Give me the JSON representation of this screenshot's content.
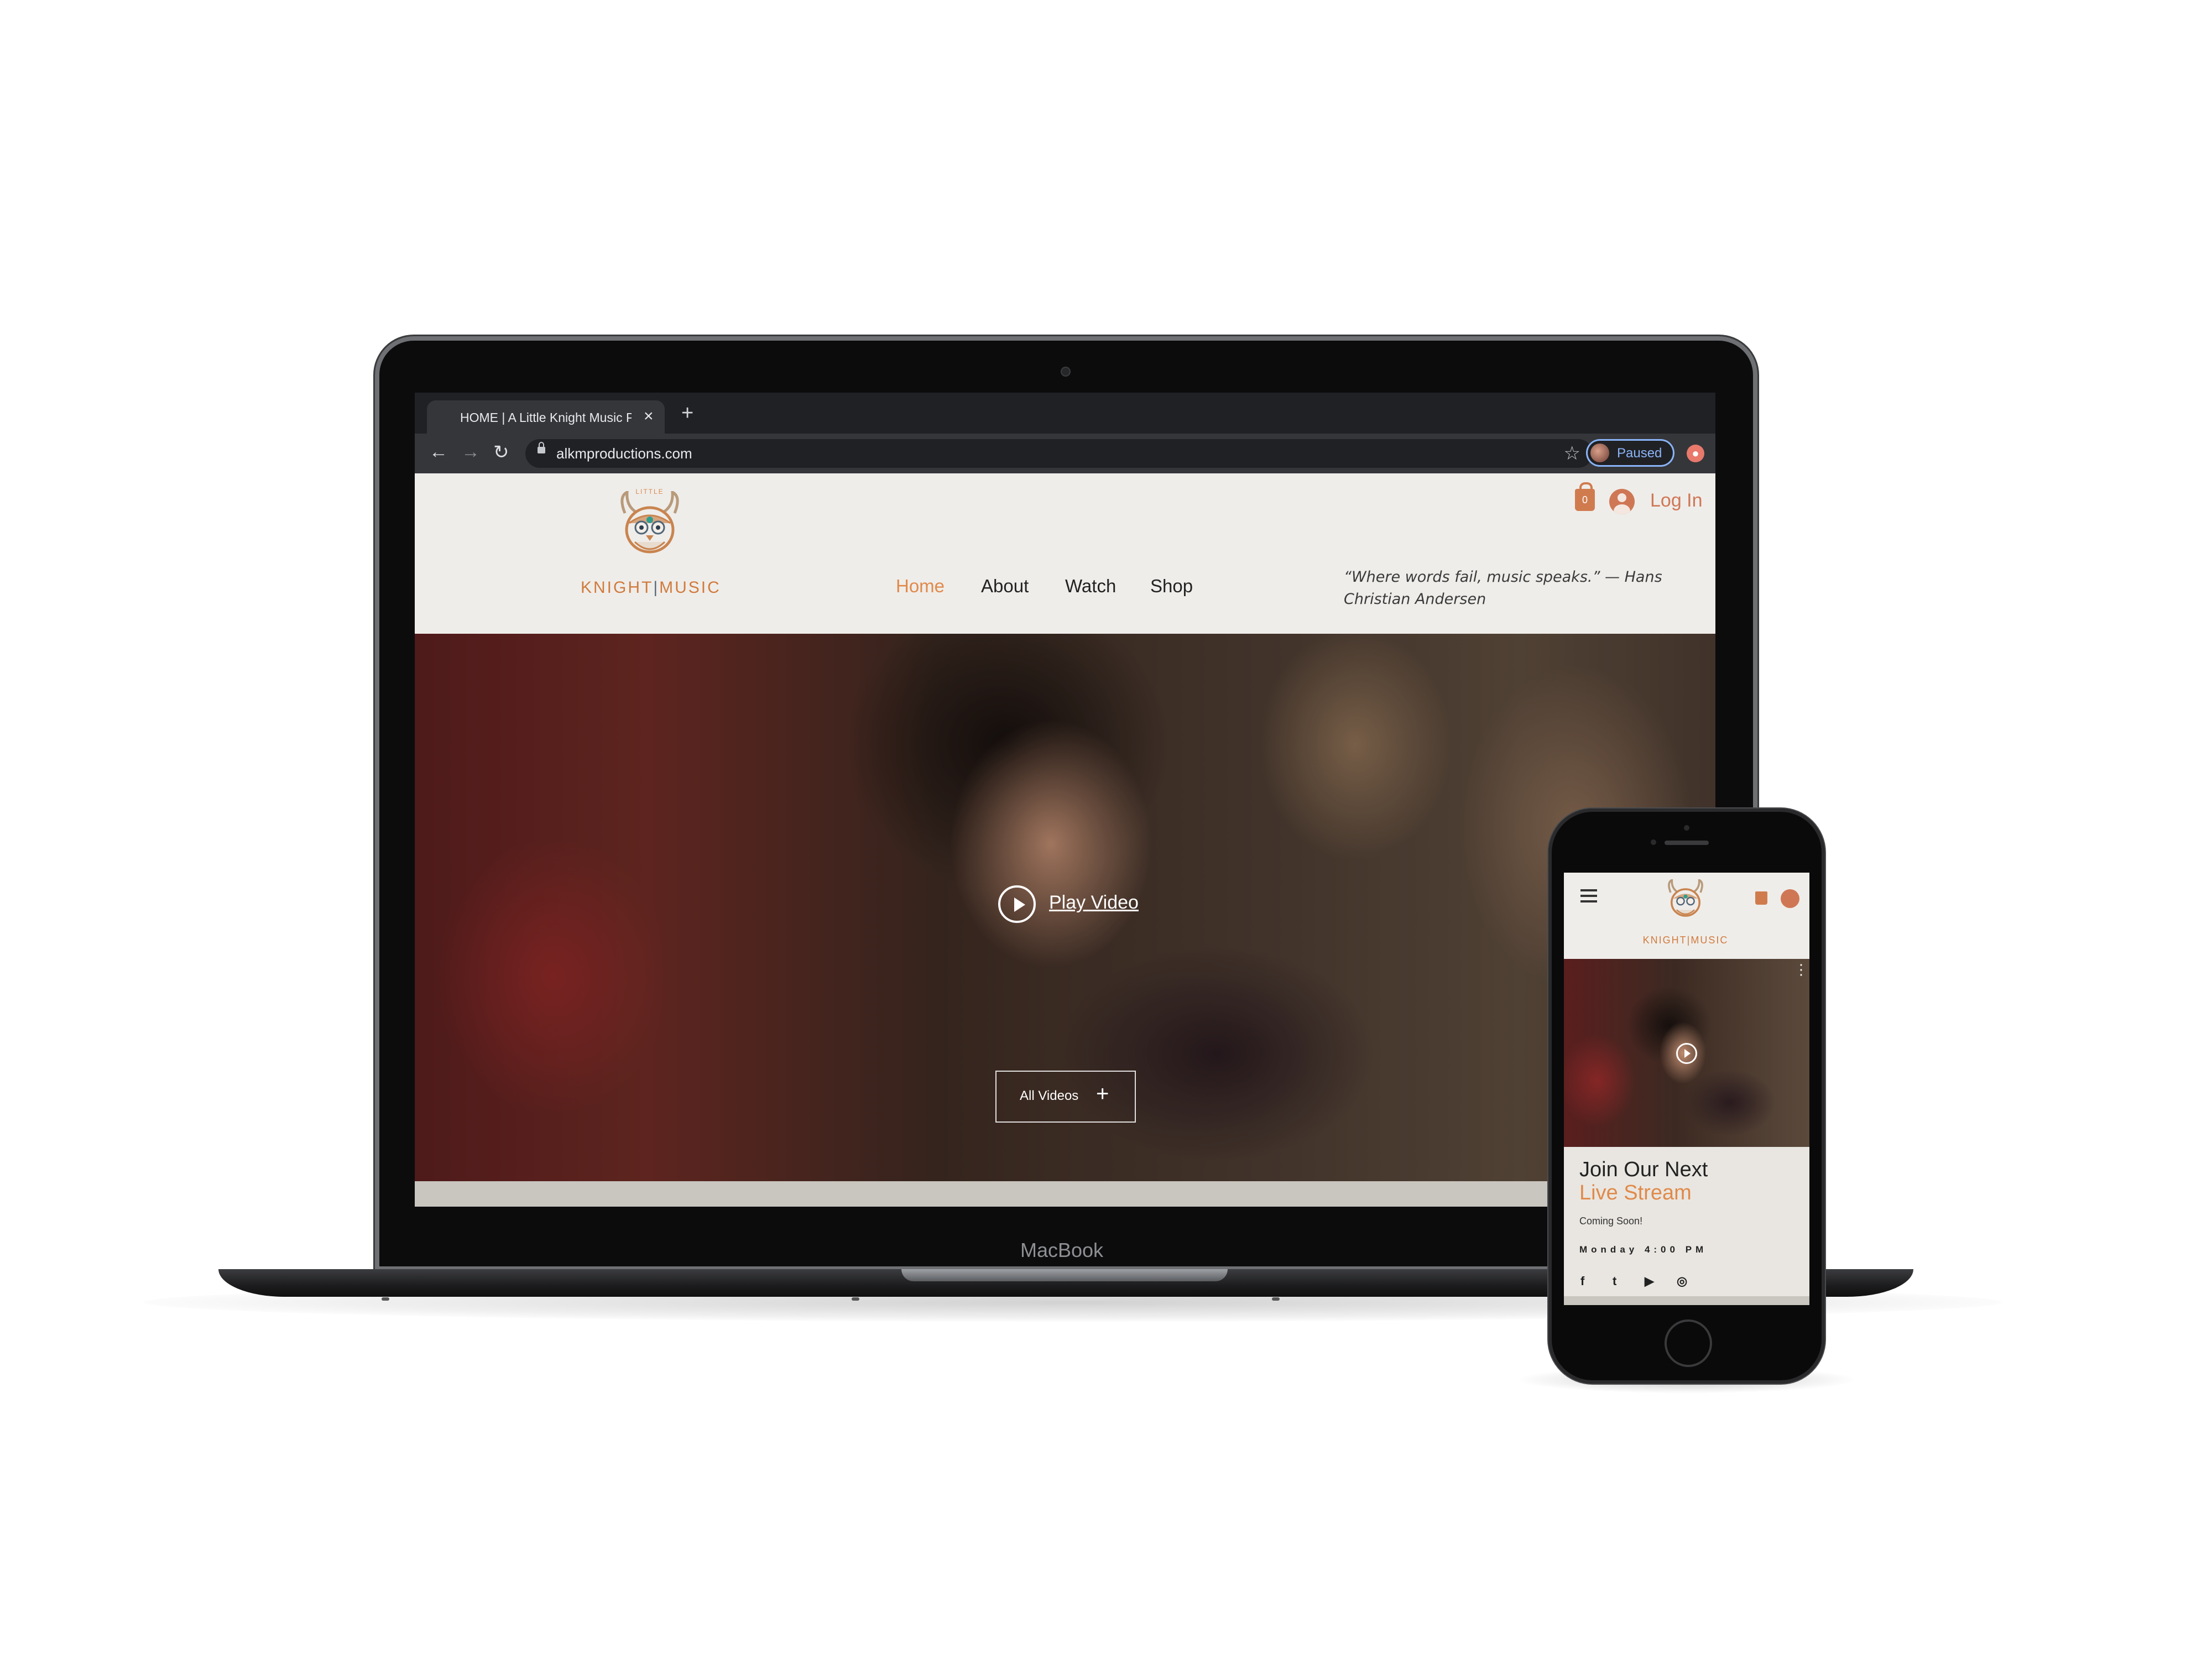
{
  "browser": {
    "tab_title": "HOME | A Little Knight Music P",
    "tab_close": "×",
    "new_tab": "+",
    "url": "alkmproductions.com",
    "back_icon": "←",
    "forward_icon": "→",
    "reload_icon": "↻",
    "bookmark_icon": "☆",
    "profile_status": "Paused"
  },
  "site": {
    "logo_small": "LITTLE",
    "logo_word_left": "KNIGHT",
    "logo_word_right": "MUSIC",
    "nav": [
      "Home",
      "About",
      "Watch",
      "Shop"
    ],
    "active_nav": "Home",
    "quote": "“Where words fail, music speaks.” — Hans Christian Andersen",
    "cart_count": "0",
    "login": "Log In",
    "play_video": "Play Video",
    "all_videos": "All Videos",
    "all_videos_icon": "+"
  },
  "laptop": {
    "label": "MacBook"
  },
  "phone": {
    "logo_word": "KNIGHT|MUSIC",
    "more_icon": "⋮",
    "title_line1": "Join Our Next",
    "title_line2": "Live Stream",
    "coming_soon": "Coming Soon!",
    "time": "Monday 4:00 PM",
    "social": [
      "f",
      "t",
      "▶",
      "◎"
    ]
  },
  "colors": {
    "accent": "#e08a4a",
    "brand": "#d07b3c",
    "header_bg": "#efedea"
  }
}
